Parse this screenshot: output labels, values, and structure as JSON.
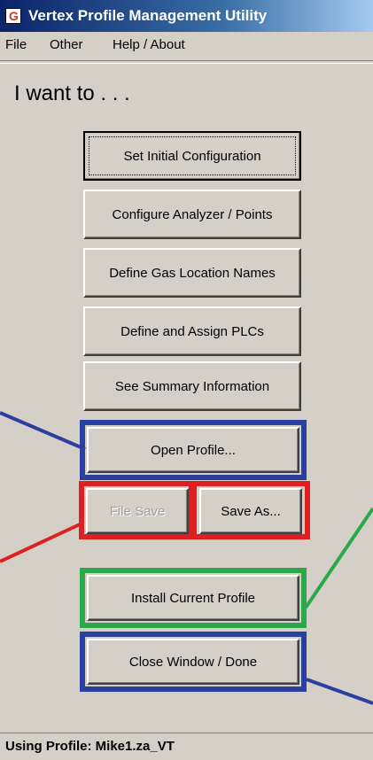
{
  "window": {
    "title": "Vertex Profile Management Utility",
    "icon": "app-logo-icon"
  },
  "menu": {
    "items": [
      "File",
      "Other",
      "Help / About"
    ]
  },
  "heading": "I want to . . .",
  "buttons": {
    "set_initial_configuration": "Set  Initial  Configuration",
    "configure_analyzer_points": "Configure  Analyzer / Points",
    "define_gas_location_names": "Define Gas Location Names",
    "define_and_assign_plcs": "Define and Assign PLCs",
    "see_summary_information": "See  Summary  Information",
    "open_profile": "Open Profile...",
    "file_save": "File Save",
    "save_as": "Save As...",
    "install_current_profile": "Install Current Profile",
    "close_window_done": "Close Window / Done"
  },
  "status": {
    "text": "Using Profile:  Mike1.za_VT"
  },
  "colors": {
    "highlight_blue": "#2a3f9e",
    "highlight_red": "#e02020",
    "highlight_green": "#2aa84a"
  }
}
